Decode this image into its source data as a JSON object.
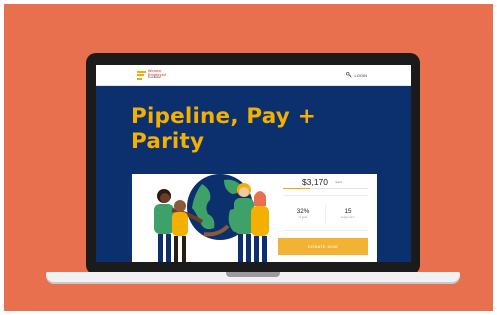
{
  "colors": {
    "background": "#e8704e",
    "site_navy": "#0c2f6e",
    "accent_yellow": "#f4b000",
    "button": "#f2b233"
  },
  "nav": {
    "logo_line1": "Women",
    "logo_line2": "Employed",
    "logo_line3": "Foundation",
    "login_icon": "key-icon",
    "login_label": "LOGIN"
  },
  "hero": {
    "title_line1": "Pipeline, Pay +",
    "title_line2": "Parity"
  },
  "campaign": {
    "illustration": "people-hugging-globe",
    "amount_raised": "$3,170",
    "goal_text": "raised",
    "progress_fraction": 0.32,
    "stats": [
      {
        "value": "32%",
        "label": "of goal"
      },
      {
        "value": "15",
        "label": "supporters"
      }
    ],
    "donate_label": "DONATE NOW"
  }
}
